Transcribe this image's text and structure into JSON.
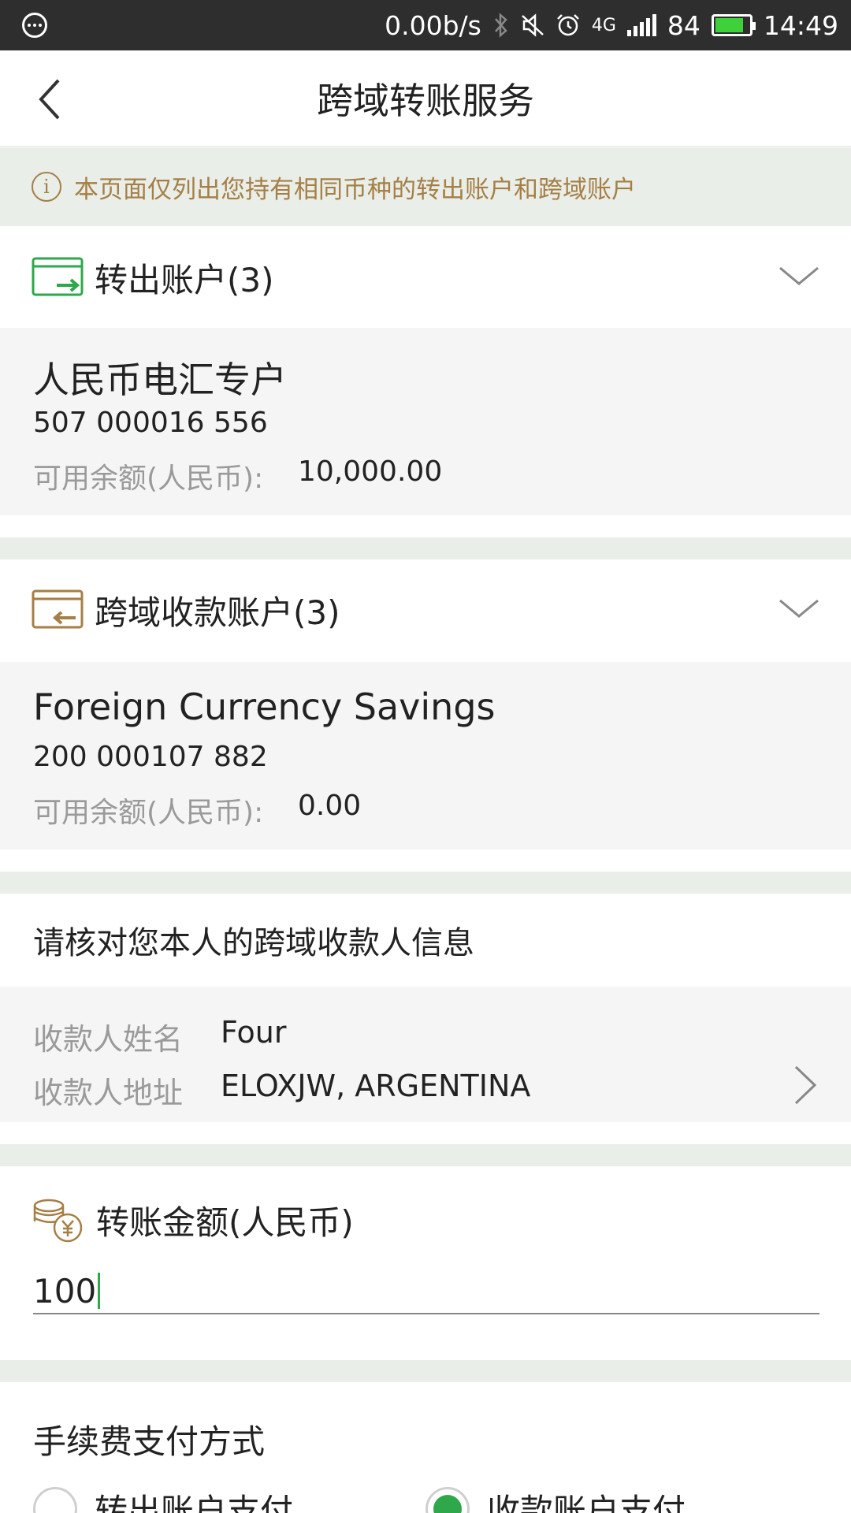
{
  "status_bar": {
    "net_speed": "0.00b/s",
    "network_type": "4G",
    "battery": "84",
    "time": "14:49",
    "icons": [
      "more-dots-icon",
      "bluetooth-icon",
      "mute-icon",
      "alarm-icon",
      "signal-icon",
      "battery-icon"
    ]
  },
  "header": {
    "title": "跨域转账服务",
    "back_icon": "back-arrow-icon"
  },
  "notice": {
    "text": "本页面仅列出您持有相同币种的转出账户和跨域账户"
  },
  "from_account": {
    "label": "转出账户(3)",
    "name": "人民币电汇专户",
    "number": "507 000016 556",
    "balance_label": "可用余额(人民币):",
    "balance": "10,000.00"
  },
  "to_account": {
    "label": "跨域收款账户(3)",
    "name": "Foreign Currency Savings",
    "number": "200 000107 882",
    "balance_label": "可用余额(人民币):",
    "balance": "0.00"
  },
  "payee": {
    "section_title": "请核对您本人的跨域收款人信息",
    "name_label": "收款人姓名",
    "name_value": "Four",
    "address_label": "收款人地址",
    "address_value": "ELOXJW, ARGENTINA"
  },
  "amount": {
    "label": "转账金额(人民币)",
    "value": "100"
  },
  "fee": {
    "title": "手续费支付方式",
    "options": [
      {
        "label": "转出账户支付",
        "selected": false
      },
      {
        "label": "收款账户支付",
        "selected": true
      }
    ]
  },
  "colors": {
    "accent_green": "#2ea84a",
    "notice_brown": "#a57f45",
    "section_gap": "#e9eee9"
  }
}
